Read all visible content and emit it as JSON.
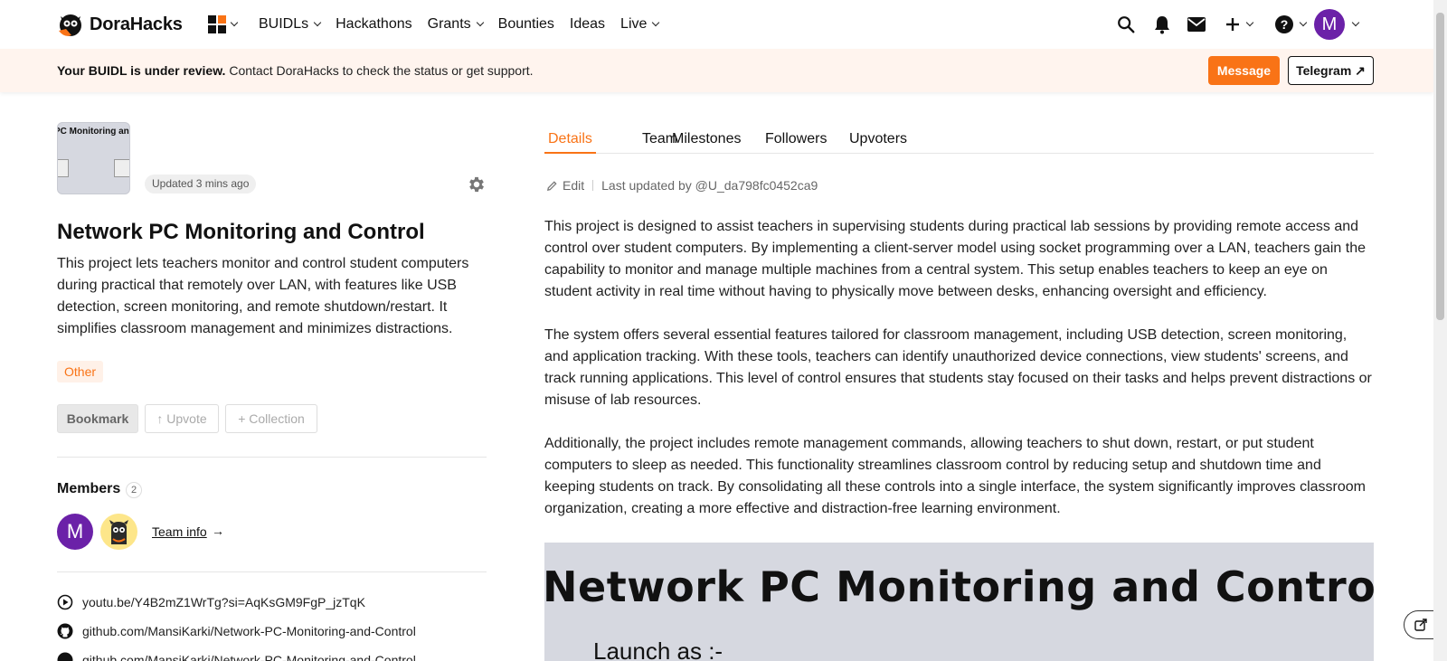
{
  "brand": {
    "name": "DoraHacks",
    "logo_icon": "dorahacks-owl-logo"
  },
  "nav": {
    "items": [
      {
        "label": "BUIDLs",
        "dropdown": true
      },
      {
        "label": "Hackathons",
        "dropdown": false
      },
      {
        "label": "Grants",
        "dropdown": true
      },
      {
        "label": "Bounties",
        "dropdown": false
      },
      {
        "label": "Ideas",
        "dropdown": false
      },
      {
        "label": "Live",
        "dropdown": true
      }
    ],
    "avatar_initial": "M"
  },
  "banner": {
    "bold_text": "Your BUIDL is under review.",
    "text": " Contact DoraHacks to check the status or get support.",
    "message_label": "Message",
    "telegram_label": "Telegram ↗"
  },
  "project": {
    "thumb_text": "PC Monitoring and Control",
    "updated": "Updated 3 mins ago",
    "title": "Network PC Monitoring and Control",
    "description": "This project lets teachers monitor and control student computers during practical that remotely over LAN, with features like USB detection, screen monitoring, and remote shutdown/restart. It simplifies classroom management and minimizes distractions.",
    "tag": "Other",
    "actions": {
      "bookmark": "Bookmark",
      "upvote": "↑ Upvote",
      "collection": "+ Collection"
    }
  },
  "members": {
    "title": "Members",
    "count": "2",
    "avatar_initial": "M",
    "team_info": "Team info",
    "team_arrow": "→"
  },
  "links": [
    {
      "icon": "play-circle-icon",
      "label": "youtu.be/Y4B2mZ1WrTg?si=AqKsGM9FgP_jzTqK"
    },
    {
      "icon": "github-icon",
      "label": "github.com/MansiKarki/Network-PC-Monitoring-and-Control"
    },
    {
      "icon": "github-icon",
      "label": "github.com/MansiKarki/Network-PC-Monitoring-and-Control"
    }
  ],
  "tabs": [
    "Details",
    "Team",
    "Milestones",
    "Followers",
    "Upvoters"
  ],
  "active_tab": "Details",
  "edit": {
    "label": "Edit",
    "last_updated": "Last updated by @U_da798fc0452ca9"
  },
  "details": [
    "This project is designed to assist teachers in supervising students during practical lab sessions by providing remote access and control over student computers. By implementing a client-server model using socket programming over a LAN, teachers gain the capability to monitor and manage multiple machines from a central system. This setup enables teachers to keep an eye on student activity in real time without having to physically move between desks, enhancing oversight and efficiency.",
    "The system offers several essential features tailored for classroom management, including USB detection, screen monitoring, and application tracking. With these tools, teachers can identify unauthorized device connections, view students' screens, and track running applications. This level of control ensures that students stay focused on their tasks and helps prevent distractions or misuse of lab resources.",
    "Additionally, the project includes remote management commands, allowing teachers to shut down, restart, or put student computers to sleep as needed. This functionality streamlines classroom control by reducing setup and shutdown time and keeping students on track. By consolidating all these controls into a single interface, the system significantly improves classroom organization, creating a more effective and distraction-free learning environment."
  ],
  "preview": {
    "title": "Network PC Monitoring and Control",
    "subtitle": "Launch as :-"
  },
  "colors": {
    "accent": "#f97316",
    "avatar": "#6b21a8",
    "banner_bg": "#fff4ee",
    "preview_bg": "#d6d8e0"
  }
}
